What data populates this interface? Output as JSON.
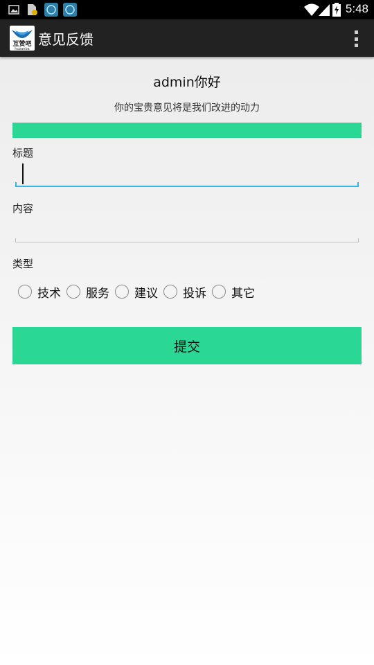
{
  "status_bar": {
    "time": "5:48",
    "icons": [
      "image-icon",
      "file-icon",
      "app-notification-icon",
      "app-notification-icon",
      "wifi-icon",
      "signal-icon",
      "battery-icon"
    ]
  },
  "action_bar": {
    "title": "意见反馈",
    "logo_text": "互赞吧",
    "logo_subtext": "huzanba"
  },
  "greeting": "admin你好",
  "subtitle": "你的宝贵意见将是我们改进的动力",
  "form": {
    "title_label": "标题",
    "title_value": "",
    "content_label": "内容",
    "content_value": "",
    "type_label": "类型",
    "type_options": [
      "技术",
      "服务",
      "建议",
      "投诉",
      "其它"
    ],
    "submit_label": "提交"
  },
  "colors": {
    "accent_green": "#2ad795",
    "focus_blue": "#33b5e5",
    "action_bar_bg": "#222222"
  }
}
